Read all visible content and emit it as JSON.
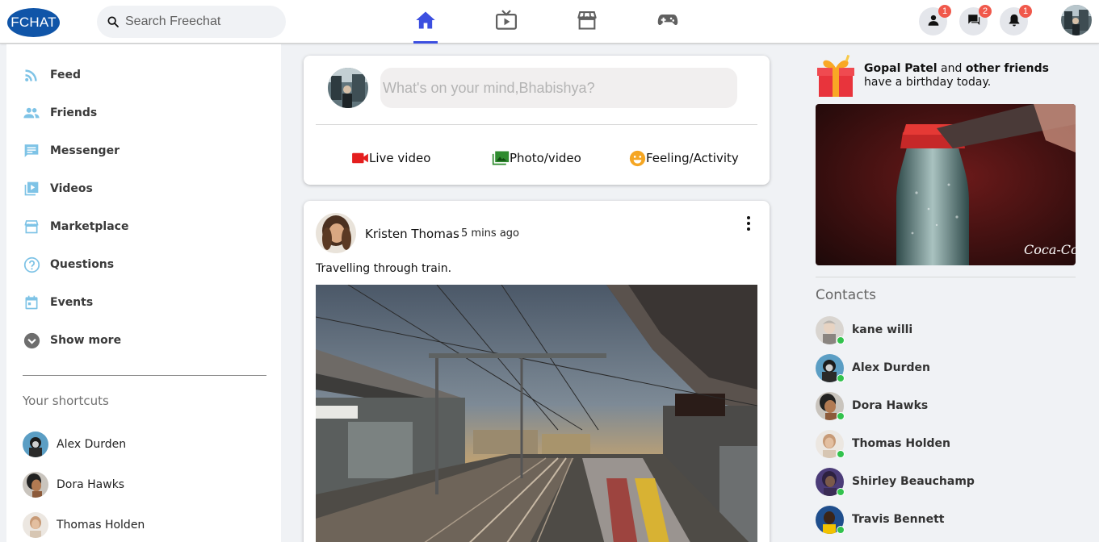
{
  "header": {
    "logo_text": "FCHAT",
    "search_placeholder": "Search Freechat",
    "nav": [
      {
        "name": "home",
        "icon": "home-icon",
        "active": true
      },
      {
        "name": "watch",
        "icon": "tv-icon",
        "active": false
      },
      {
        "name": "marketplace",
        "icon": "store-icon",
        "active": false
      },
      {
        "name": "gaming",
        "icon": "gamepad-icon",
        "active": false
      }
    ],
    "badges": {
      "friend_requests": "1",
      "messages": "2",
      "notifications": "1"
    },
    "accent_color": "#3c4fe0",
    "badge_color": "#f0584b"
  },
  "sidebar": {
    "items": [
      {
        "label": "Feed",
        "icon": "rss-icon"
      },
      {
        "label": "Friends",
        "icon": "people-icon"
      },
      {
        "label": "Messenger",
        "icon": "chat-icon"
      },
      {
        "label": "Videos",
        "icon": "video-library-icon"
      },
      {
        "label": "Marketplace",
        "icon": "store-icon"
      },
      {
        "label": "Questions",
        "icon": "help-icon"
      },
      {
        "label": "Events",
        "icon": "calendar-icon"
      },
      {
        "label": "Show more",
        "icon": "expand-more-icon"
      }
    ],
    "shortcuts_title": "Your shortcuts",
    "shortcuts": [
      {
        "name": "Alex Durden"
      },
      {
        "name": "Dora Hawks"
      },
      {
        "name": "Thomas Holden"
      }
    ]
  },
  "composer": {
    "placeholder": "What's on your mind,Bhabishya?",
    "actions": [
      {
        "label": "Live video",
        "icon": "video-camera-icon",
        "color": "#e41e1e"
      },
      {
        "label": "Photo/video",
        "icon": "photo-library-icon",
        "color": "#2e8b2e"
      },
      {
        "label": "Feeling/Activity",
        "icon": "smiley-icon",
        "color": "#f5a623"
      }
    ]
  },
  "post": {
    "author": "Kristen Thomas",
    "time": "5 mins ago",
    "caption": "Travelling through train."
  },
  "rightbar": {
    "birthday_name": "Gopal Patel",
    "birthday_and": "and",
    "birthday_friends": "other friends",
    "birthday_suffix": "have a birthday today.",
    "contacts_title": "Contacts",
    "contacts": [
      {
        "name": "kane willi"
      },
      {
        "name": "Alex Durden"
      },
      {
        "name": "Dora Hawks"
      },
      {
        "name": "Thomas Holden"
      },
      {
        "name": "Shirley Beauchamp"
      },
      {
        "name": "Travis Bennett"
      }
    ]
  }
}
